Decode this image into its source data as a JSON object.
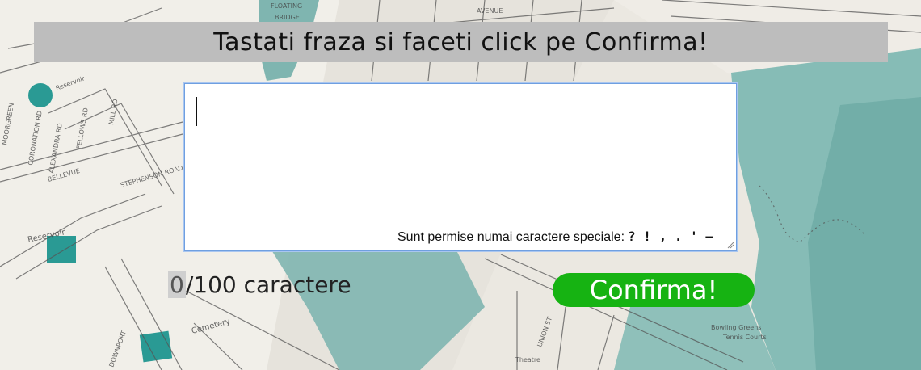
{
  "header": {
    "title": "Tastati fraza si faceti click pe Confirma!"
  },
  "input": {
    "value": "",
    "hint_text": "Sunt permise numai caractere speciale:",
    "allowed_chars": "? ! , . ' –"
  },
  "counter": {
    "current": "0",
    "suffix": "/100 caractere"
  },
  "confirm": {
    "label": "Confirma!"
  },
  "background": {
    "street_labels": [
      "FLOATING BRIDGE",
      "AVENUE",
      "Reservoir",
      "Reservoir",
      "STEPHENSON ROAD",
      "BELLEVUE",
      "MOORGREEN",
      "CORONATION RD",
      "ALEXANDRA RD",
      "FELLOWS RD",
      "MILL RD",
      "Cemetery",
      "Theatre",
      "Bowling Greens",
      "Tennis Courts",
      "UNION ST",
      "DOWNPORT"
    ]
  },
  "colors": {
    "header_bg": "#bdbdbd",
    "button_bg": "#16b312",
    "water": "#7fb5b0",
    "reservoir": "#2a9a94"
  }
}
